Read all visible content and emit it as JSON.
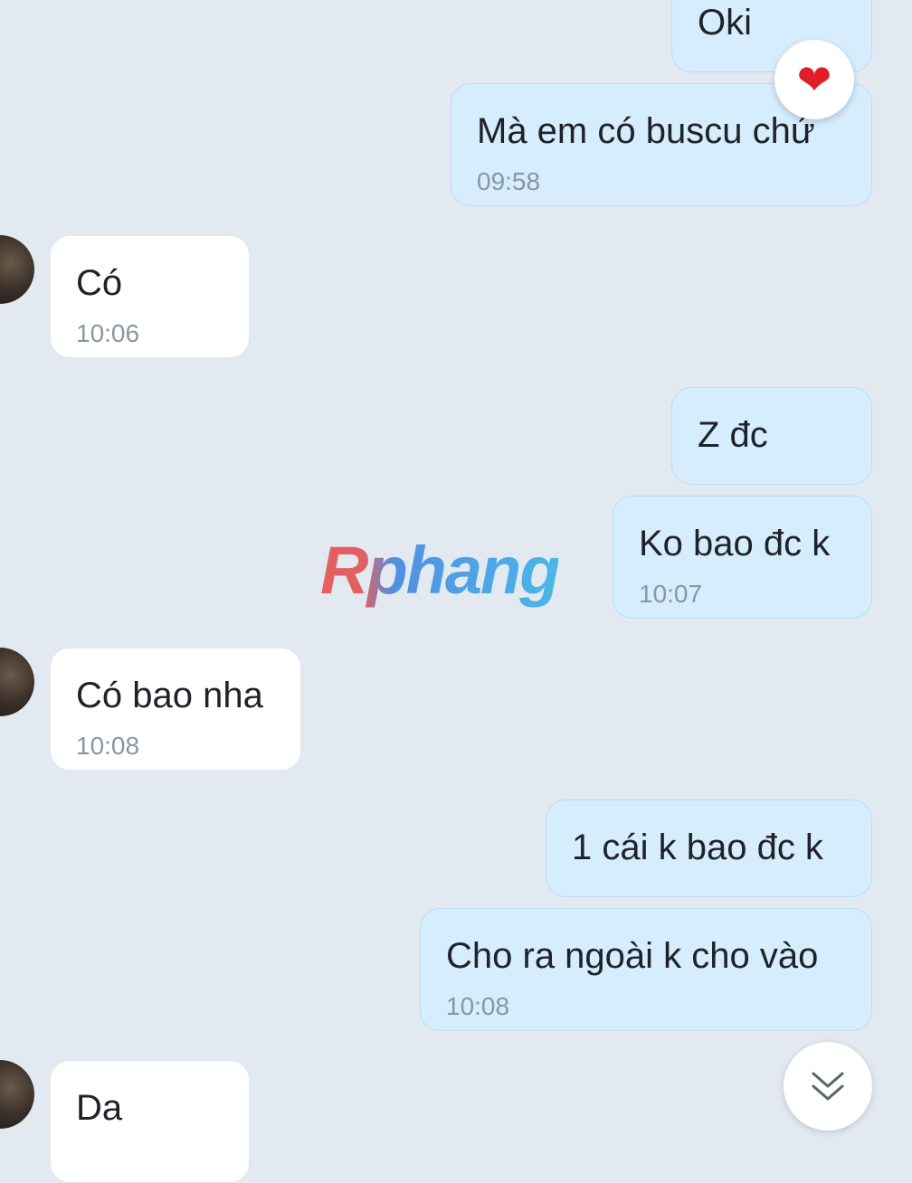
{
  "messages": [
    {
      "text": "Oki",
      "time": ""
    },
    {
      "text": "Mà em có buscu chứ",
      "time": "09:58"
    },
    {
      "text": "Có",
      "time": "10:06"
    },
    {
      "text": "Z đc",
      "time": ""
    },
    {
      "text": "Ko bao đc k",
      "time": "10:07"
    },
    {
      "text": "Có bao nha",
      "time": "10:08"
    },
    {
      "text": "1 cái k bao đc k",
      "time": ""
    },
    {
      "text": "Cho ra ngoài k cho vào",
      "time": "10:08"
    },
    {
      "text": "Da",
      "time": ""
    }
  ],
  "reaction": {
    "icon": "heart-icon",
    "glyph": "❤"
  },
  "watermark": {
    "text": "Rphang"
  },
  "scroll_down": {
    "icon": "double-chevron-down-icon"
  },
  "colors": {
    "background": "#e2e9f1",
    "outgoing_bubble": "#d5edfd",
    "incoming_bubble": "#ffffff",
    "timestamp": "#8a96a3",
    "reaction": "#e11d2a"
  }
}
